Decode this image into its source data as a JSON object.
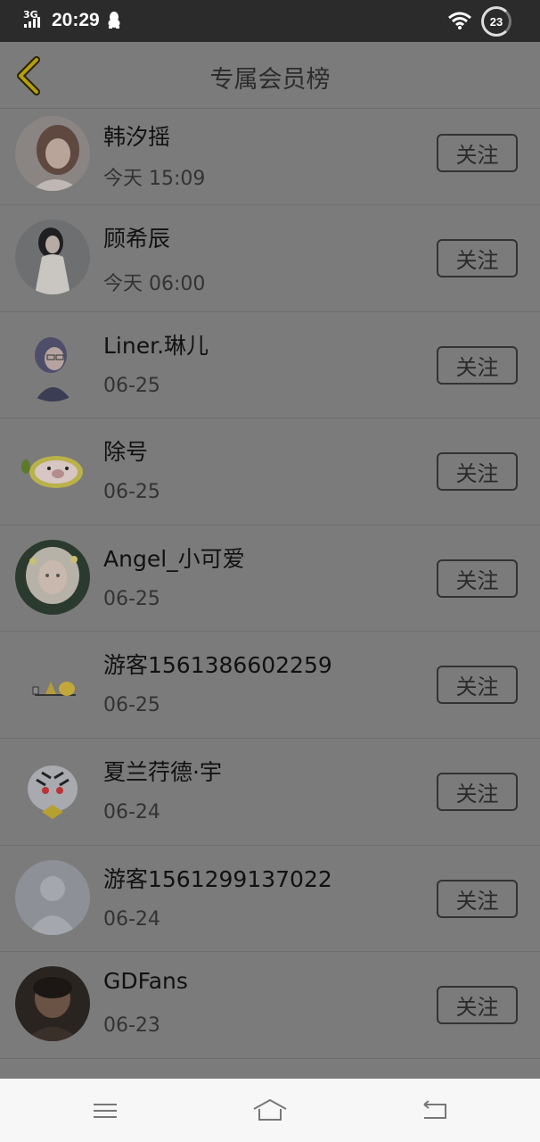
{
  "status_bar": {
    "network": "3G",
    "time": "20:29",
    "battery": "23"
  },
  "header": {
    "title": "专属会员榜"
  },
  "members": [
    {
      "name": "韩汐摇",
      "time": "今天 15:09",
      "follow_label": "关注",
      "avatar": "girl-portrait-avatar"
    },
    {
      "name": "顾希辰",
      "time": "今天 06:00",
      "follow_label": "关注",
      "avatar": "girl-white-dress-avatar"
    },
    {
      "name": "Liner.琳儿",
      "time": "06-25",
      "follow_label": "关注",
      "avatar": "anime-girl-glasses-avatar"
    },
    {
      "name": "除号",
      "time": "06-25",
      "follow_label": "关注",
      "avatar": "pig-lemon-avatar"
    },
    {
      "name": "Angel_小可爱",
      "time": "06-25",
      "follow_label": "关注",
      "avatar": "anime-white-hair-avatar"
    },
    {
      "name": "游客1561386602259",
      "time": "06-25",
      "follow_label": "关注",
      "avatar": "small-characters-avatar"
    },
    {
      "name": "夏兰荇德·宇",
      "time": "06-24",
      "follow_label": "关注",
      "avatar": "tiger-avatar"
    },
    {
      "name": "游客1561299137022",
      "time": "06-24",
      "follow_label": "关注",
      "avatar": "default-person-avatar"
    },
    {
      "name": "GDFans",
      "time": "06-23",
      "follow_label": "关注",
      "avatar": "dark-photo-avatar"
    }
  ],
  "colors": {
    "overlay_background": "#7b7b7b",
    "status_bar": "#2b2b2b",
    "back_arrow": "#b5a00a",
    "nav_bar": "#f7f7f7"
  }
}
